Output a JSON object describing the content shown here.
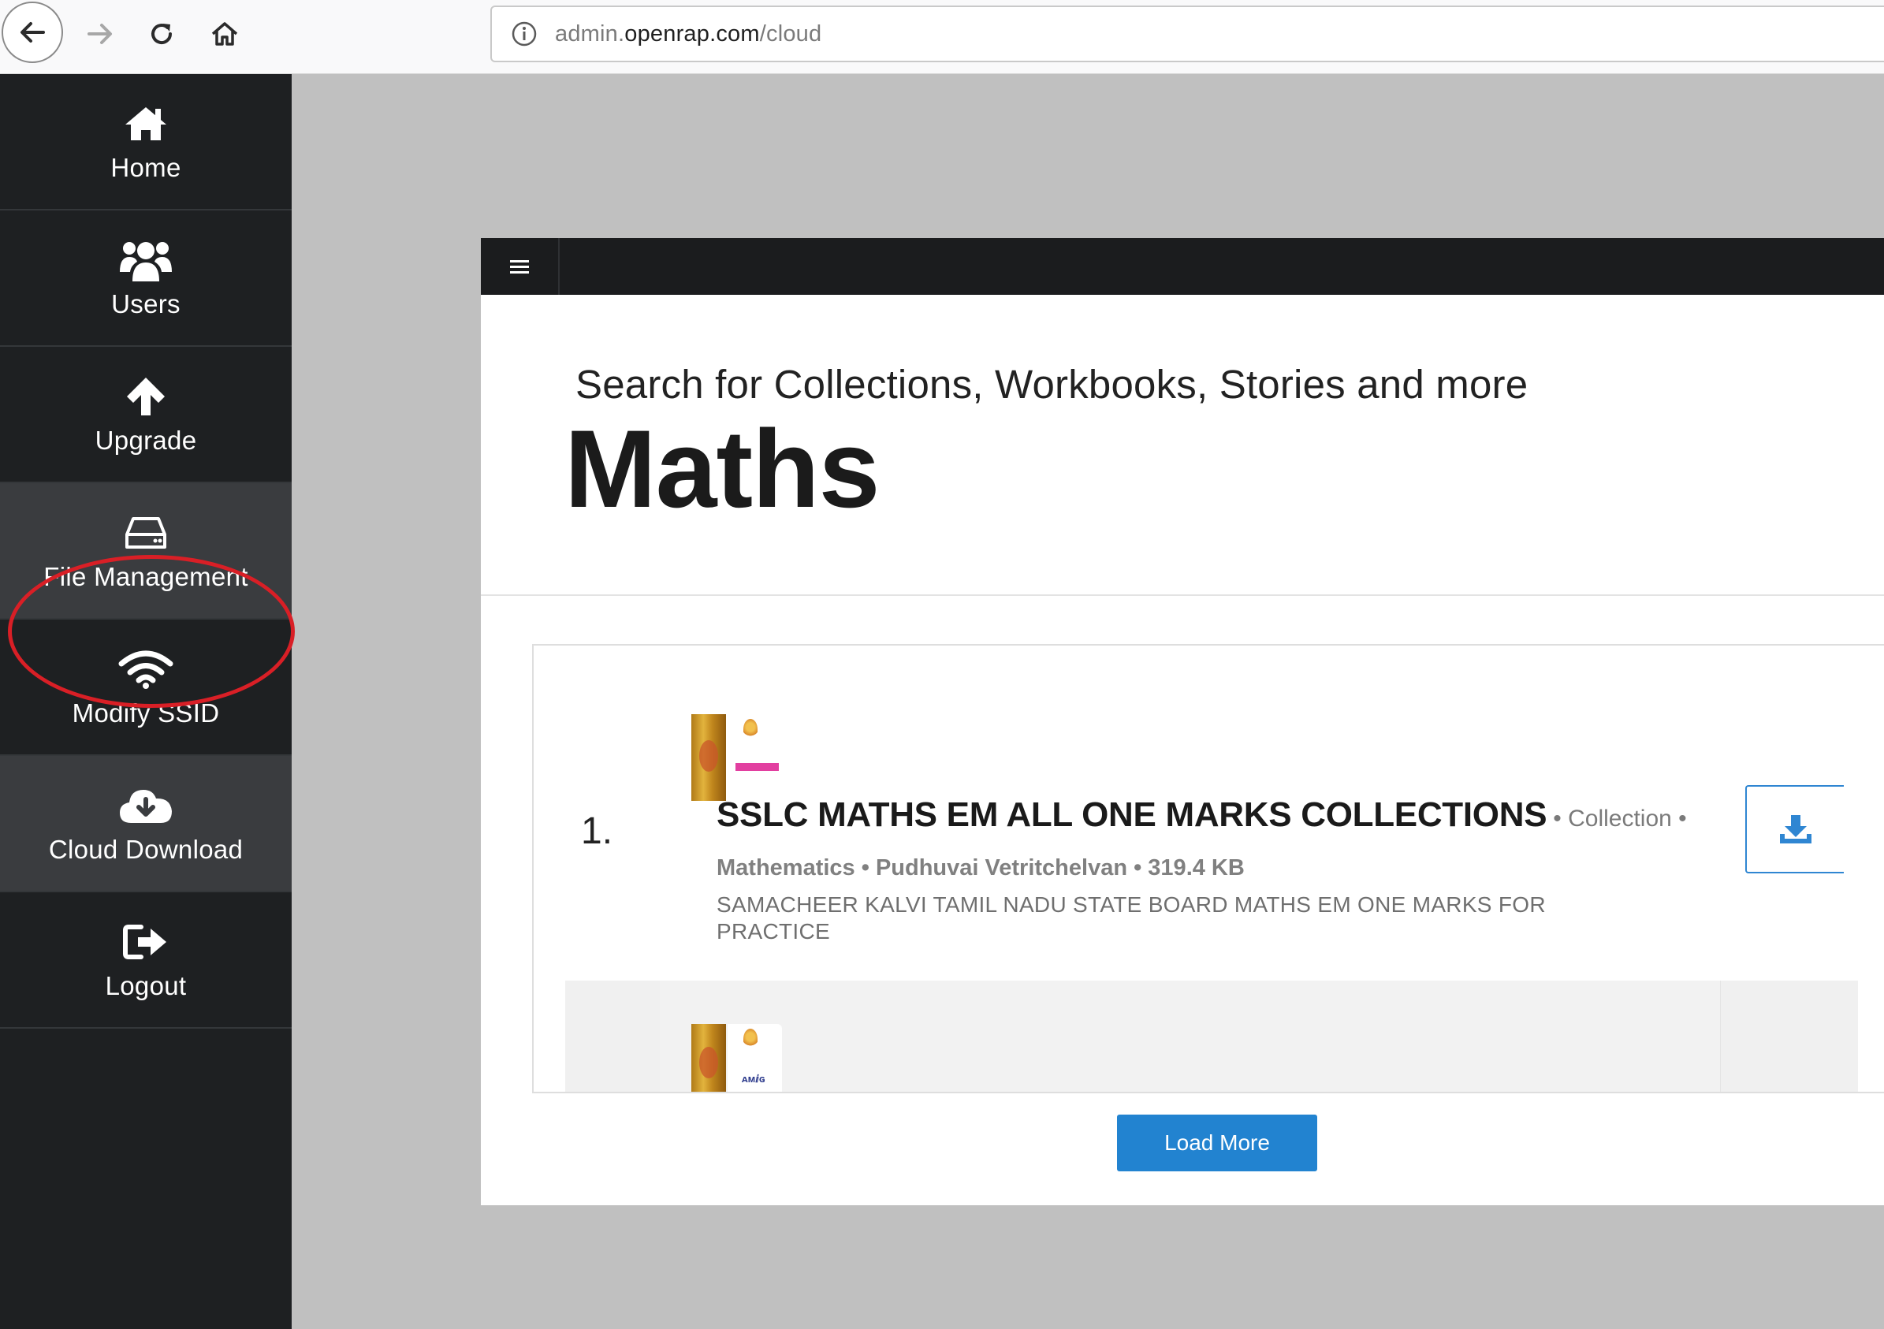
{
  "browser": {
    "url_prefix": "admin.",
    "url_domain": "openrap.com",
    "url_path": "/cloud"
  },
  "sidebar": {
    "items": [
      {
        "label": "Home",
        "icon": "home-icon"
      },
      {
        "label": "Users",
        "icon": "users-icon"
      },
      {
        "label": "Upgrade",
        "icon": "arrow-up-icon"
      },
      {
        "label": "File Management",
        "icon": "hard-drive-icon"
      },
      {
        "label": "Modify SSID",
        "icon": "wifi-icon"
      },
      {
        "label": "Cloud Download",
        "icon": "cloud-download-icon"
      },
      {
        "label": "Logout",
        "icon": "sign-out-icon"
      }
    ],
    "annotation_color": "#d91f26"
  },
  "main": {
    "search_hint": "Search for Collections, Workbooks, Stories and more",
    "title": "Maths",
    "results": [
      {
        "number": "1.",
        "title": "SSLC MATHS EM ALL ONE MARKS COLLECTIONS",
        "type_inline": "• Collection •",
        "meta": "Mathematics • Pudhuvai Vetritchelvan • 319.4 KB",
        "description": "SAMACHEER KALVI TAMIL NADU STATE BOARD MATHS EM ONE MARKS FOR PRACTICE",
        "action_icon": "download-icon"
      }
    ],
    "load_more_label": "Load More"
  },
  "colors": {
    "sidebar_bg": "#1e2022",
    "accent": "#2283d0",
    "canvas_bg": "#c0c0c0"
  }
}
